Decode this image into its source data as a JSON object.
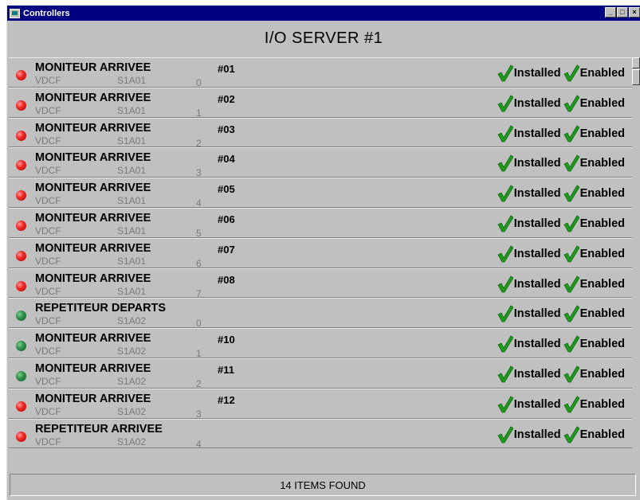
{
  "window": {
    "title": "Controllers"
  },
  "header": {
    "title": "I/O SERVER #1"
  },
  "status_labels": {
    "installed": "Installed",
    "enabled": "Enabled"
  },
  "colors": {
    "red_led": "#e02020",
    "green_led": "#2e8b48",
    "check": "#1f9a1f",
    "titlebar": "#000080"
  },
  "rows": [
    {
      "name": "MONITEUR ARRIVEE",
      "type": "VDCF",
      "address": "S1A01",
      "channel": "0",
      "number": "#01",
      "led": "red"
    },
    {
      "name": "MONITEUR ARRIVEE",
      "type": "VDCF",
      "address": "S1A01",
      "channel": "1",
      "number": "#02",
      "led": "red"
    },
    {
      "name": "MONITEUR ARRIVEE",
      "type": "VDCF",
      "address": "S1A01",
      "channel": "2",
      "number": "#03",
      "led": "red"
    },
    {
      "name": "MONITEUR ARRIVEE",
      "type": "VDCF",
      "address": "S1A01",
      "channel": "3",
      "number": "#04",
      "led": "red"
    },
    {
      "name": "MONITEUR ARRIVEE",
      "type": "VDCF",
      "address": "S1A01",
      "channel": "4",
      "number": "#05",
      "led": "red"
    },
    {
      "name": "MONITEUR ARRIVEE",
      "type": "VDCF",
      "address": "S1A01",
      "channel": "5",
      "number": "#06",
      "led": "red"
    },
    {
      "name": "MONITEUR ARRIVEE",
      "type": "VDCF",
      "address": "S1A01",
      "channel": "6",
      "number": "#07",
      "led": "red"
    },
    {
      "name": "MONITEUR ARRIVEE",
      "type": "VDCF",
      "address": "S1A01",
      "channel": "7",
      "number": "#08",
      "led": "red"
    },
    {
      "name": "REPETITEUR DEPARTS",
      "type": "VDCF",
      "address": "S1A02",
      "channel": "0",
      "number": "",
      "led": "green"
    },
    {
      "name": "MONITEUR ARRIVEE",
      "type": "VDCF",
      "address": "S1A02",
      "channel": "1",
      "number": "#10",
      "led": "green"
    },
    {
      "name": "MONITEUR ARRIVEE",
      "type": "VDCF",
      "address": "S1A02",
      "channel": "2",
      "number": "#11",
      "led": "green"
    },
    {
      "name": "MONITEUR ARRIVEE",
      "type": "VDCF",
      "address": "S1A02",
      "channel": "3",
      "number": "#12",
      "led": "red"
    },
    {
      "name": "REPETITEUR ARRIVEE",
      "type": "VDCF",
      "address": "S1A02",
      "channel": "4",
      "number": "",
      "led": "red"
    }
  ],
  "footer": {
    "status_text": "14 ITEMS FOUND"
  }
}
